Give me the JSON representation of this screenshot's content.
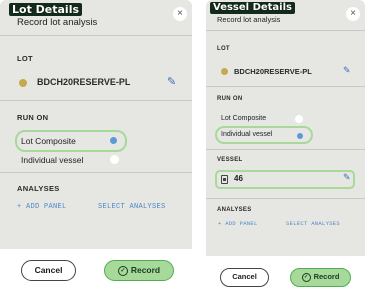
{
  "left": {
    "caption": "Lot Details",
    "title": "Record lot analysis",
    "close_icon": "×",
    "lot_label": "LOT",
    "lot_name": "BDCH20RESERVE-PL",
    "run_on_label": "RUN ON",
    "options": [
      {
        "label": "Lot Composite",
        "selected": true
      },
      {
        "label": "Individual vessel",
        "selected": false
      }
    ],
    "analyses_label": "ANALYSES",
    "add_panel": "+ ADD PANEL",
    "select_analyses": "SELECT ANALYSES",
    "cancel": "Cancel",
    "record": "Record"
  },
  "right": {
    "caption": "Vessel Details",
    "title": "Record lot analysis",
    "close_icon": "×",
    "lot_label": "LOT",
    "lot_name": "BDCH20RESERVE-PL",
    "run_on_label": "RUN ON",
    "options": [
      {
        "label": "Lot Composite",
        "selected": false
      },
      {
        "label": "Individual vessel",
        "selected": true
      }
    ],
    "vessel_label": "VESSEL",
    "vessel_value": "46",
    "analyses_label": "ANALYSES",
    "add_panel": "+ ADD PANEL",
    "select_analyses": "SELECT ANALYSES",
    "cancel": "Cancel",
    "record": "Record"
  },
  "colors": {
    "panel_bg": "#e6e7e3",
    "lot_dot": "#c6a84d",
    "accent_blue": "#5b9ad8",
    "selection_green": "#a6d99a",
    "caption_bg": "#122b1a"
  },
  "icons": {
    "lot": "color-dot-icon",
    "edit": "pencil-icon",
    "vessel": "tank-icon",
    "record": "check-circle-icon",
    "close": "close-icon"
  }
}
